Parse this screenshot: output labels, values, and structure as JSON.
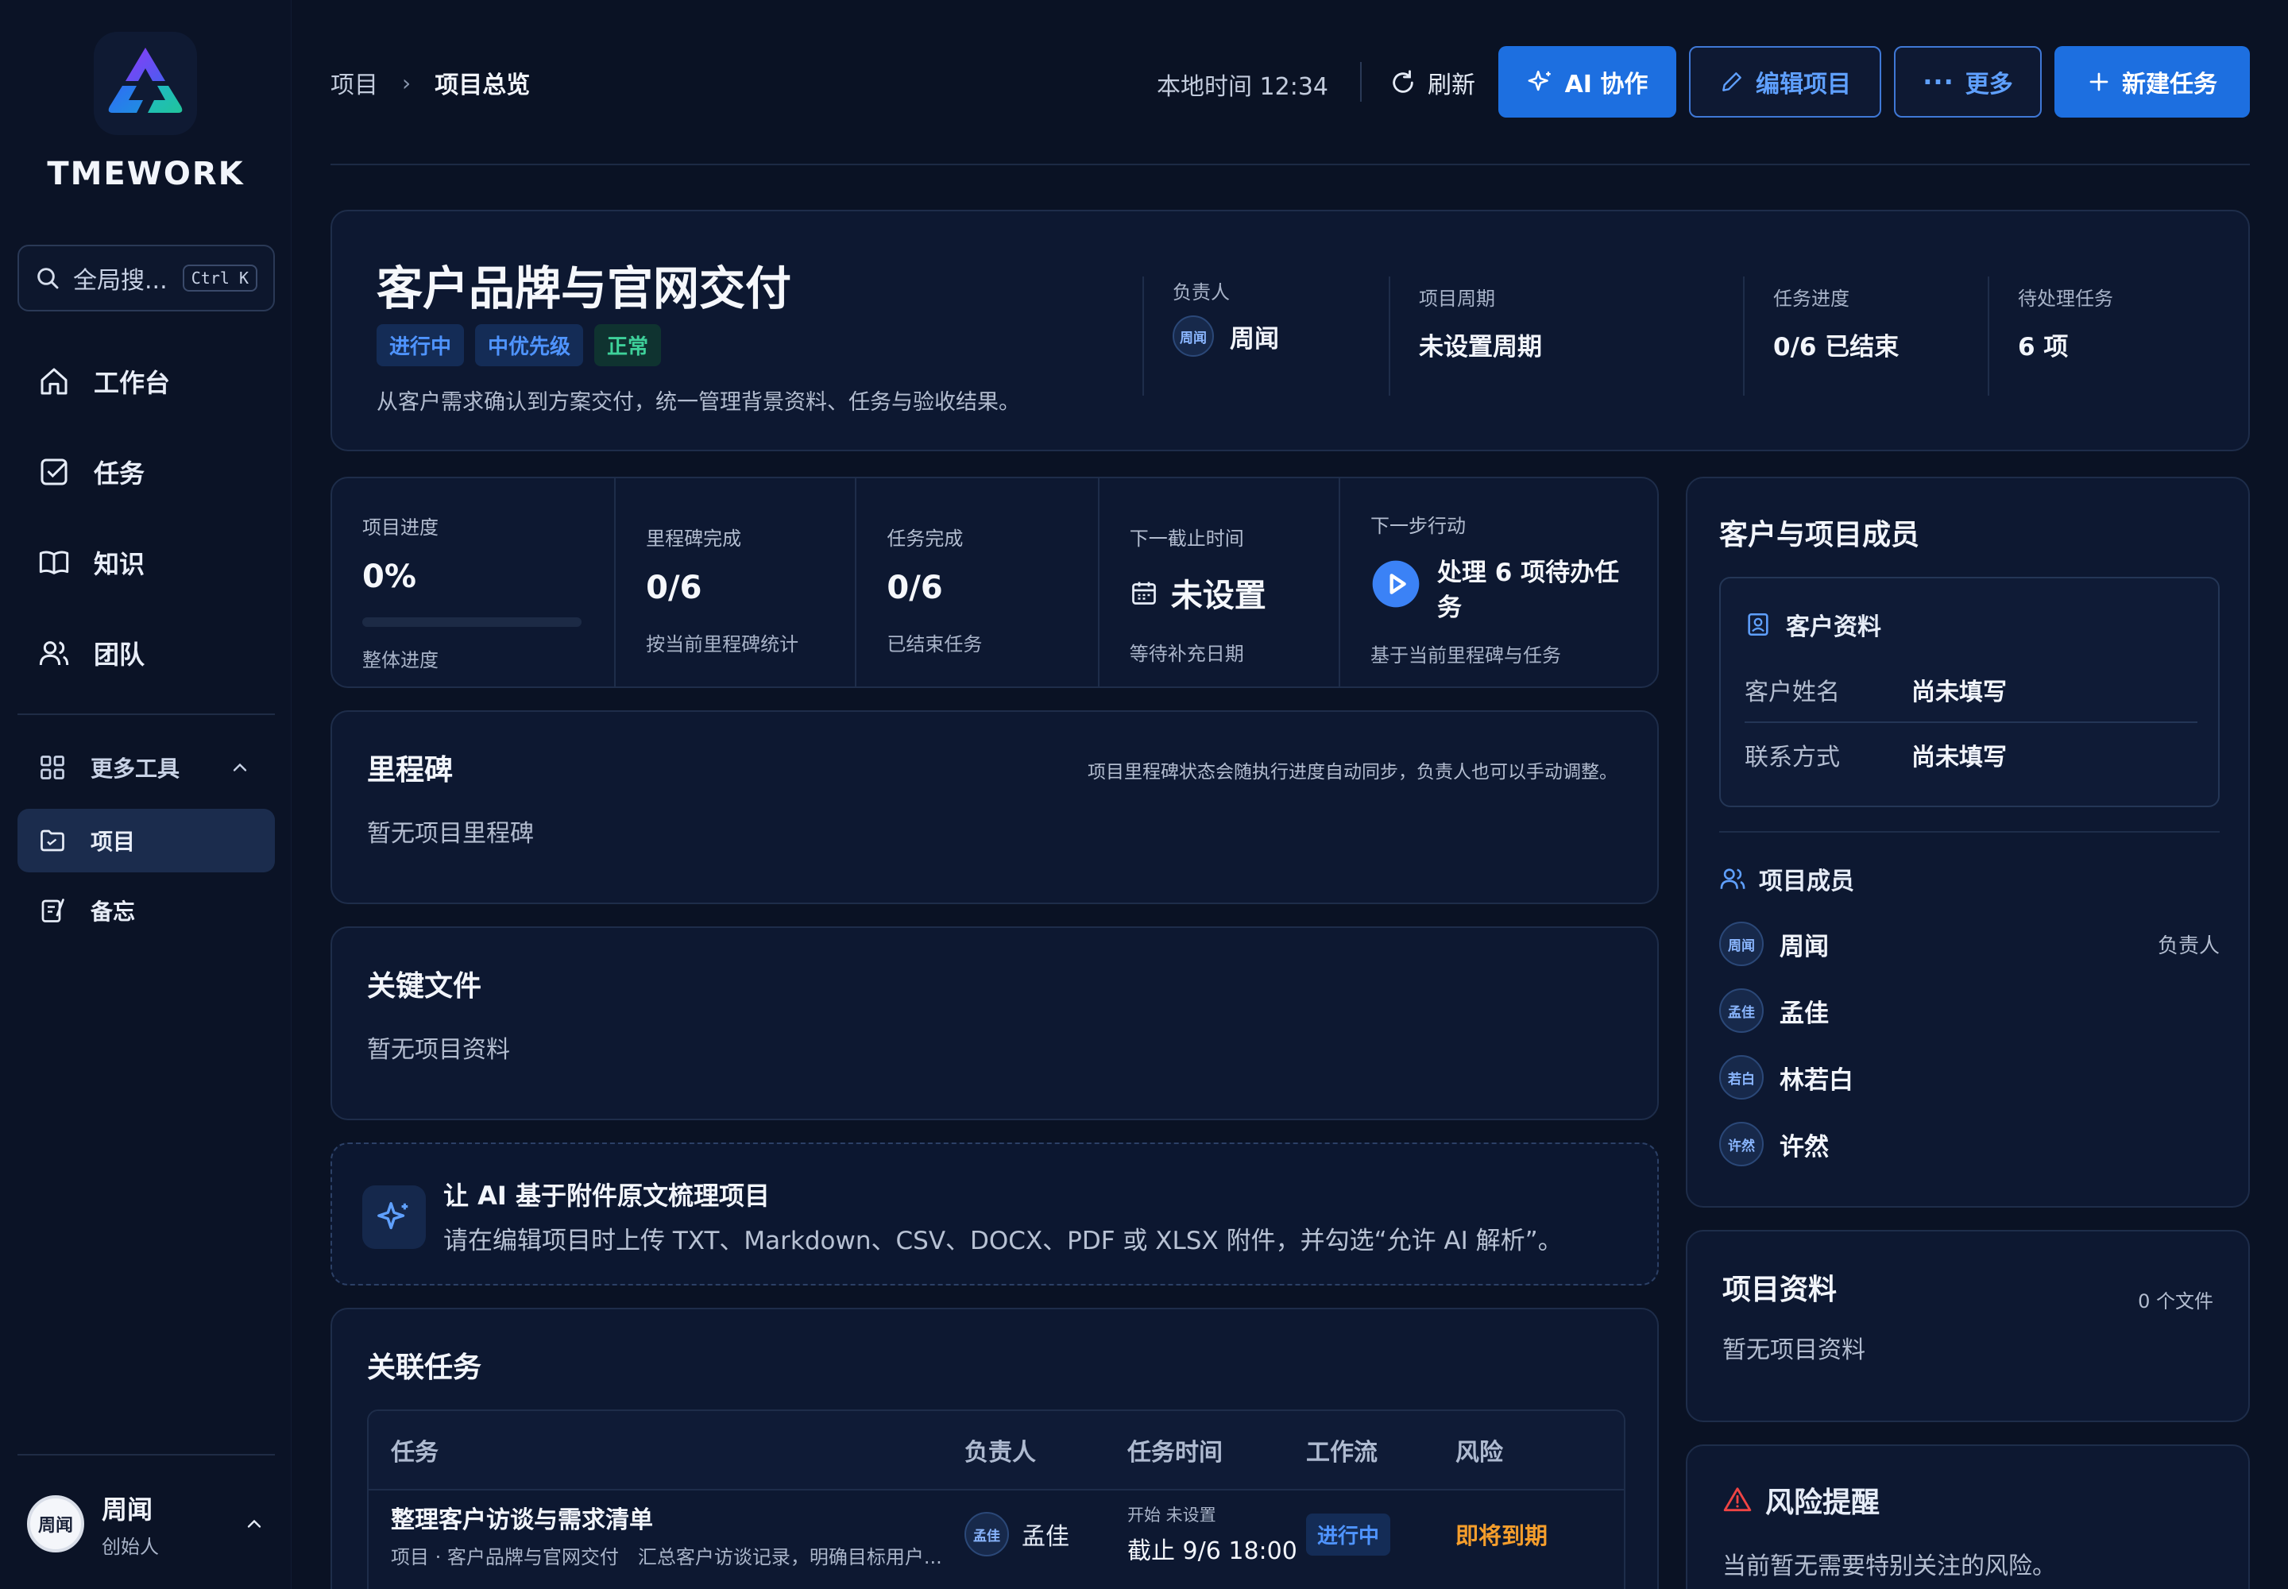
{
  "app": {
    "brand": "TMEWORK"
  },
  "sidebar": {
    "search_placeholder": "全局搜...",
    "search_shortcut": "Ctrl K",
    "items": [
      {
        "label": "工作台",
        "icon": "home-icon"
      },
      {
        "label": "任务",
        "icon": "checkbox-icon"
      },
      {
        "label": "知识",
        "icon": "book-icon"
      },
      {
        "label": "团队",
        "icon": "users-icon"
      }
    ],
    "more_tools": {
      "label": "更多工具",
      "icon": "grid-icon"
    },
    "sub_items": [
      {
        "label": "项目",
        "icon": "folder-icon",
        "active": true
      },
      {
        "label": "备忘",
        "icon": "memo-icon",
        "active": false
      }
    ],
    "user": {
      "avatar": "周闻",
      "name": "周闻",
      "role": "创始人"
    }
  },
  "topbar": {
    "breadcrumb": [
      "项目",
      "项目总览"
    ],
    "local_time_label": "本地时间 12:34",
    "refresh_label": "刷新",
    "ai_label": "AI 协作",
    "edit_label": "编辑项目",
    "more_label": "更多",
    "new_task_label": "新建任务"
  },
  "project": {
    "title": "客户品牌与官网交付",
    "tags": [
      {
        "label": "进行中",
        "color": "#4f94ff"
      },
      {
        "label": "中优先级",
        "color": "#4f94ff"
      },
      {
        "label": "正常",
        "color": "#3ed19a"
      }
    ],
    "description": "从客户需求确认到方案交付，统一管理背景资料、任务与验收结果。",
    "owner_label": "负责人",
    "owner_avatar": "周闻",
    "owner_name": "周闻",
    "period_label": "项目周期",
    "period_value": "未设置周期",
    "progress_label": "任务进度",
    "progress_value": "0/6 已结束",
    "pending_label": "待处理任务",
    "pending_value": "6 项"
  },
  "stats": {
    "progress": {
      "label": "项目进度",
      "value": "0%",
      "fraction": 0,
      "sub": "整体进度"
    },
    "milestones": {
      "label": "里程碑完成",
      "value": "0/6",
      "sub": "按当前里程碑统计"
    },
    "tasks": {
      "label": "任务完成",
      "value": "0/6",
      "sub": "已结束任务"
    },
    "deadline": {
      "label": "下一截止时间",
      "value": "未设置",
      "sub": "等待补充日期"
    },
    "next": {
      "label": "下一步行动",
      "value": "处理 6 项待办任务",
      "sub": "基于当前里程碑与任务"
    }
  },
  "milestones": {
    "title": "里程碑",
    "note": "项目里程碑状态会随执行进度自动同步，负责人也可以手动调整。",
    "empty": "暂无项目里程碑"
  },
  "key_files": {
    "title": "关键文件",
    "empty": "暂无项目资料"
  },
  "ai_hint": {
    "title": "让 AI 基于附件原文梳理项目",
    "desc": "请在编辑项目时上传 TXT、Markdown、CSV、DOCX、PDF 或 XLSX 附件，并勾选“允许 AI 解析”。"
  },
  "tasks": {
    "title": "关联任务",
    "columns": [
      "任务",
      "负责人",
      "任务时间",
      "工作流",
      "风险"
    ],
    "rows": [
      {
        "name": "整理客户访谈与需求清单",
        "sub": "项目 · 客户品牌与官网交付　汇总客户访谈记录，明确目标用户...",
        "owner_avatar": "孟佳",
        "owner": "孟佳",
        "start": "开始 未设置",
        "due": "截止 9/6 18:00",
        "workflow": "进行中",
        "risk": "即将到期"
      }
    ]
  },
  "members_card": {
    "title": "客户与项目成员",
    "customer": {
      "title": "客户资料",
      "name_label": "客户姓名",
      "name_value": "尚未填写",
      "contact_label": "联系方式",
      "contact_value": "尚未填写"
    },
    "members_title": "项目成员",
    "members": [
      {
        "avatar": "周闻",
        "name": "周闻",
        "role": "负责人"
      },
      {
        "avatar": "孟佳",
        "name": "孟佳",
        "role": ""
      },
      {
        "avatar": "若白",
        "name": "林若白",
        "role": ""
      },
      {
        "avatar": "许然",
        "name": "许然",
        "role": ""
      }
    ]
  },
  "project_data": {
    "title": "项目资料",
    "count": "0 个文件",
    "empty": "暂无项目资料"
  },
  "risk": {
    "title": "风险提醒",
    "desc": "当前暂无需要特别关注的风险。"
  }
}
